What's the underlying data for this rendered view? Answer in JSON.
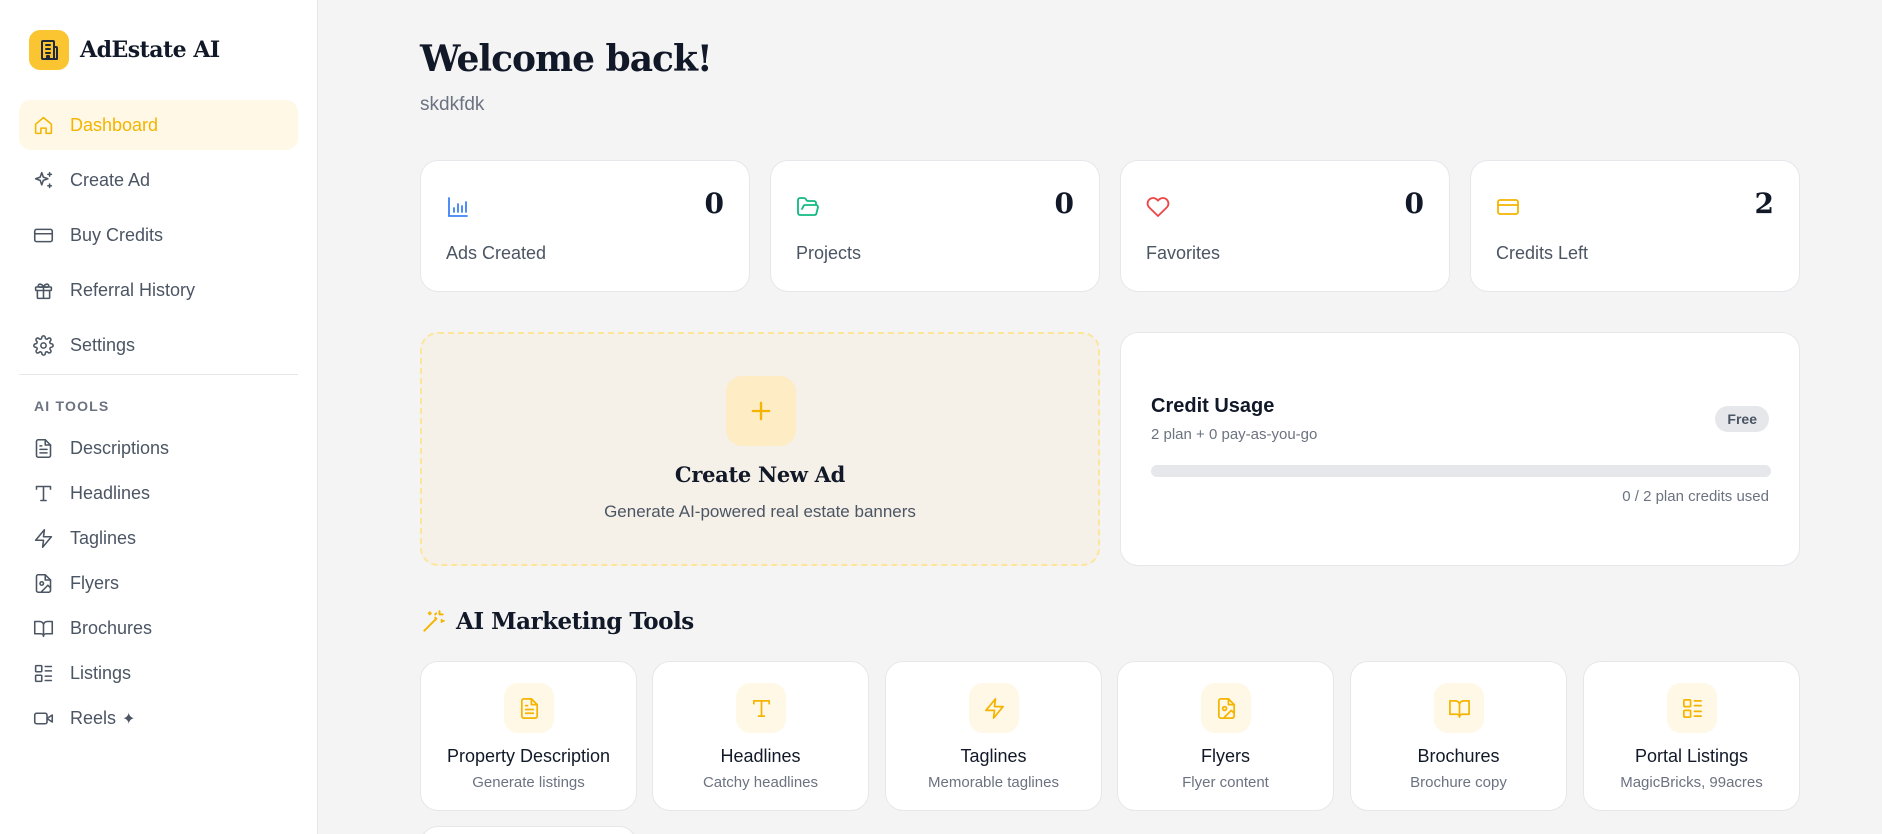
{
  "app": {
    "name": "AdEstate AI"
  },
  "sidebar": {
    "nav": [
      {
        "label": "Dashboard",
        "icon": "home-icon",
        "active": true
      },
      {
        "label": "Create Ad",
        "icon": "sparkles-icon"
      },
      {
        "label": "Buy Credits",
        "icon": "credit-card-icon"
      },
      {
        "label": "Referral History",
        "icon": "gift-icon"
      },
      {
        "label": "Settings",
        "icon": "gear-icon"
      }
    ],
    "section_label": "AI TOOLS",
    "tools": [
      {
        "label": "Descriptions",
        "icon": "file-text-icon"
      },
      {
        "label": "Headlines",
        "icon": "type-icon"
      },
      {
        "label": "Taglines",
        "icon": "zap-icon"
      },
      {
        "label": "Flyers",
        "icon": "file-image-icon"
      },
      {
        "label": "Brochures",
        "icon": "book-open-icon"
      },
      {
        "label": "Listings",
        "icon": "list-icon"
      },
      {
        "label": "Reels",
        "icon": "video-icon",
        "suffix": "✦"
      }
    ]
  },
  "header": {
    "title": "Welcome back!",
    "subtitle": "skdkfdk"
  },
  "stats": [
    {
      "label": "Ads Created",
      "value": "0",
      "icon": "bar-chart-icon",
      "color": "#3b82f6"
    },
    {
      "label": "Projects",
      "value": "0",
      "icon": "folder-open-icon",
      "color": "#10b981"
    },
    {
      "label": "Favorites",
      "value": "0",
      "icon": "heart-icon",
      "color": "#ef4444"
    },
    {
      "label": "Credits Left",
      "value": "2",
      "icon": "credit-card-icon",
      "color": "#f4b400"
    }
  ],
  "create_card": {
    "title": "Create New Ad",
    "subtitle": "Generate AI-powered real estate banners"
  },
  "credit_usage": {
    "title": "Credit Usage",
    "subtitle": "2 plan + 0 pay-as-you-go",
    "badge": "Free",
    "used_text": "0 / 2 plan credits used",
    "progress_fraction": 0
  },
  "marketing_tools": {
    "title": "AI Marketing Tools",
    "items": [
      {
        "name": "Property Description",
        "desc": "Generate listings",
        "icon": "file-text-icon"
      },
      {
        "name": "Headlines",
        "desc": "Catchy headlines",
        "icon": "type-icon"
      },
      {
        "name": "Taglines",
        "desc": "Memorable taglines",
        "icon": "zap-icon"
      },
      {
        "name": "Flyers",
        "desc": "Flyer content",
        "icon": "file-image-icon"
      },
      {
        "name": "Brochures",
        "desc": "Brochure copy",
        "icon": "book-open-icon"
      },
      {
        "name": "Portal Listings",
        "desc": "MagicBricks, 99acres",
        "icon": "list-icon"
      }
    ]
  },
  "colors": {
    "accent": "#fbc531",
    "accent_text": "#f4b400",
    "accent_bg": "#fff8e6"
  }
}
